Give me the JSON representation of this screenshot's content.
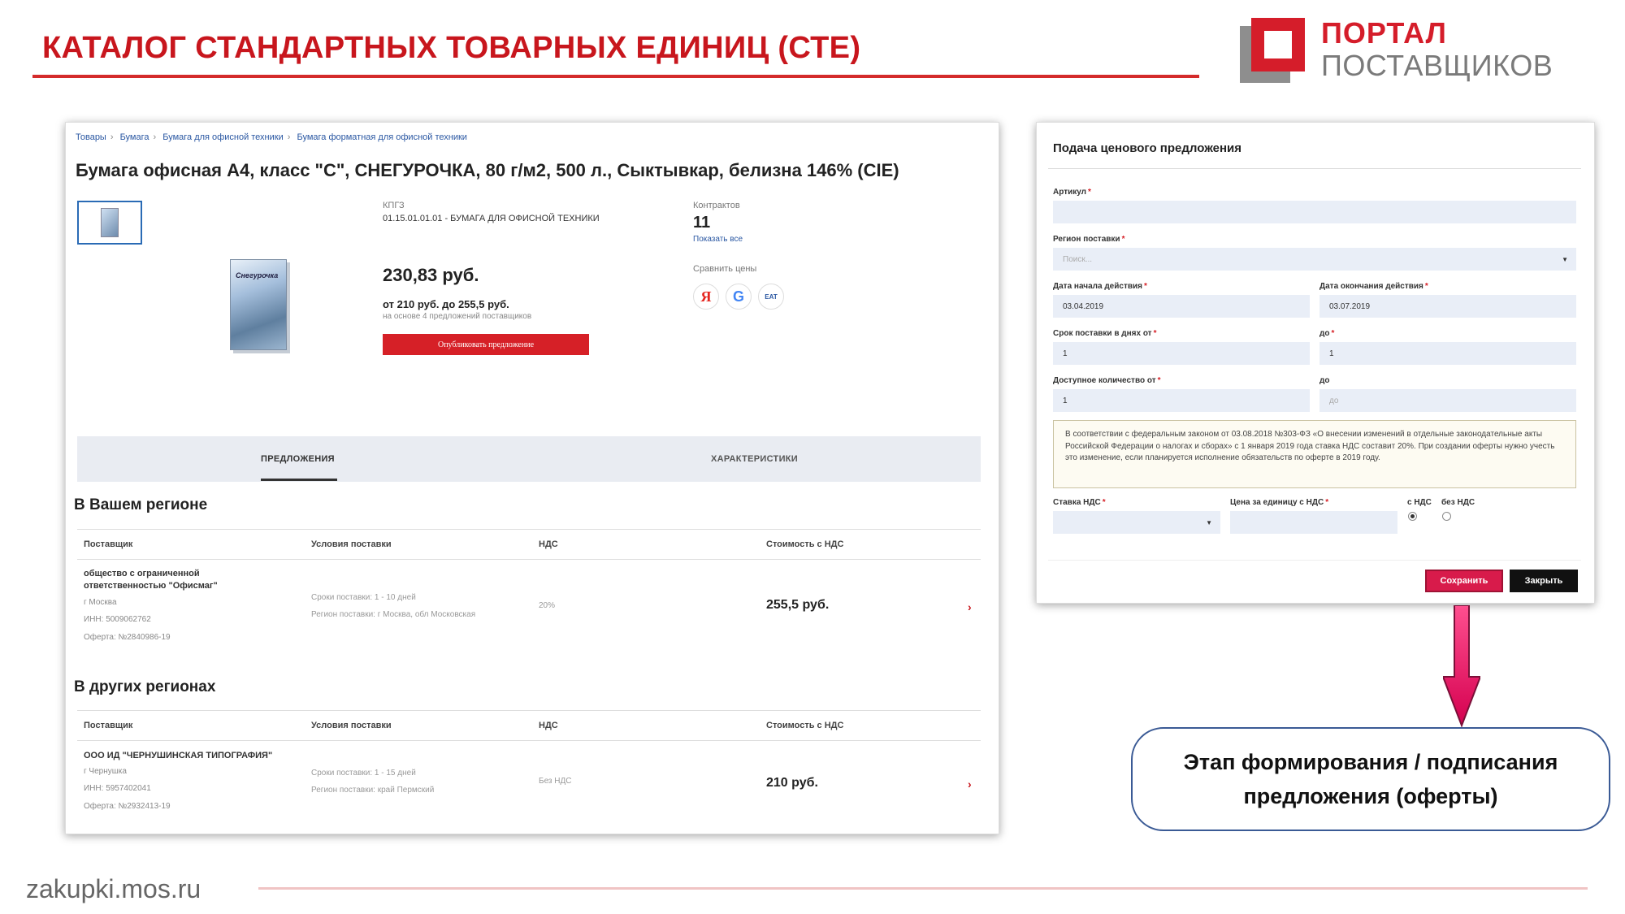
{
  "slide": {
    "title": "КАТАЛОГ СТАНДАРТНЫХ ТОВАРНЫХ ЕДИНИЦ (СТЕ)",
    "logo_line1": "ПОРТАЛ",
    "logo_line2": "ПОСТАВЩИКОВ",
    "footer_url": "zakupki.mos.ru",
    "callout_line1": "Этап формирования / подписания",
    "callout_line2": "предложения (оферты)"
  },
  "catalog": {
    "breadcrumb": [
      "Товары",
      "Бумага",
      "Бумага для офисной техники",
      "Бумага форматная для офисной техники"
    ],
    "product_title": "Бумага офисная А4, класс \"С\", СНЕГУРОЧКА, 80 г/м2, 500 л., Сыктывкар, белизна 146% (CIE)",
    "pack_brand": "Снегурочка",
    "kpgz_label": "КПГЗ",
    "kpgz_value": "01.15.01.01.01 - БУМАГА ДЛЯ ОФИСНОЙ ТЕХНИКИ",
    "price": "230,83 руб.",
    "price_range": "от 210 руб. до 255,5 руб.",
    "price_note": "на основе 4 предложений поставщиков",
    "publish_label": "Опубликовать предложение",
    "contracts_label": "Контрактов",
    "contracts_count": "11",
    "show_all": "Показать все",
    "compare_label": "Сравнить цены",
    "compare_icons": [
      "Я",
      "G",
      "EAT"
    ],
    "tabs": [
      "ПРЕДЛОЖЕНИЯ",
      "ХАРАКТЕРИСТИКИ"
    ],
    "table_columns": [
      "Поставщик",
      "Условия поставки",
      "НДС",
      "Стоимость с НДС"
    ],
    "sections": [
      {
        "heading": "В Вашем регионе",
        "rows": [
          {
            "supplier": "общество с ограниченной ответственностью \"Офисмаг\"",
            "city": "г Москва",
            "inn": "ИНН: 5009062762",
            "offer": "Оферта: №2840986-19",
            "terms": "Сроки поставки: 1 - 10 дней",
            "region": "Регион поставки: г Москва, обл Московская",
            "vat": "20%",
            "cost": "255,5 руб.",
            "arrow": "›"
          }
        ]
      },
      {
        "heading": "В других регионах",
        "rows": [
          {
            "supplier": "ООО ИД \"ЧЕРНУШИНСКАЯ ТИПОГРАФИЯ\"",
            "city": "г Чернушка",
            "inn": "ИНН: 5957402041",
            "offer": "Оферта: №2932413-19",
            "terms": "Сроки поставки: 1 - 15 дней",
            "region": "Регион поставки: край Пермский",
            "vat": "Без НДС",
            "cost": "210 руб.",
            "arrow": "›"
          }
        ]
      }
    ]
  },
  "offer_form": {
    "title": "Подача ценового предложения",
    "required_mark": "*",
    "article_label": "Артикул",
    "article_value": "",
    "region_label": "Регион поставки",
    "region_placeholder": "Поиск...",
    "start_date_label": "Дата начала действия",
    "start_date_value": "03.04.2019",
    "end_date_label": "Дата окончания действия",
    "end_date_value": "03.07.2019",
    "delivery_from_label": "Срок поставки в днях от",
    "delivery_from_value": "1",
    "delivery_to_label": "до",
    "delivery_to_value": "1",
    "qty_from_label": "Доступное количество от",
    "qty_from_value": "1",
    "qty_to_label": "до",
    "qty_to_placeholder": "до",
    "notice": "В соответствии с федеральным законом от 03.08.2018 №303-ФЗ «О внесении изменений в отдельные законодательные акты Российской Федерации о налогах и сборах» с 1 января 2019 года ставка НДС составит 20%. При создании оферты нужно учесть это изменение, если планируется исполнение обязательств по оферте в 2019 году.",
    "vat_rate_label": "Ставка НДС",
    "unit_price_label": "Цена за единицу с НДС",
    "with_vat_label": "с НДС",
    "without_vat_label": "без НДС",
    "with_vat_selected": true,
    "save_label": "Сохранить",
    "close_label": "Закрыть"
  },
  "colors": {
    "brand_red": "#c8161d",
    "save_button": "#d81b4b",
    "callout_border": "#3a5a95",
    "arrow": "#e0105c"
  }
}
